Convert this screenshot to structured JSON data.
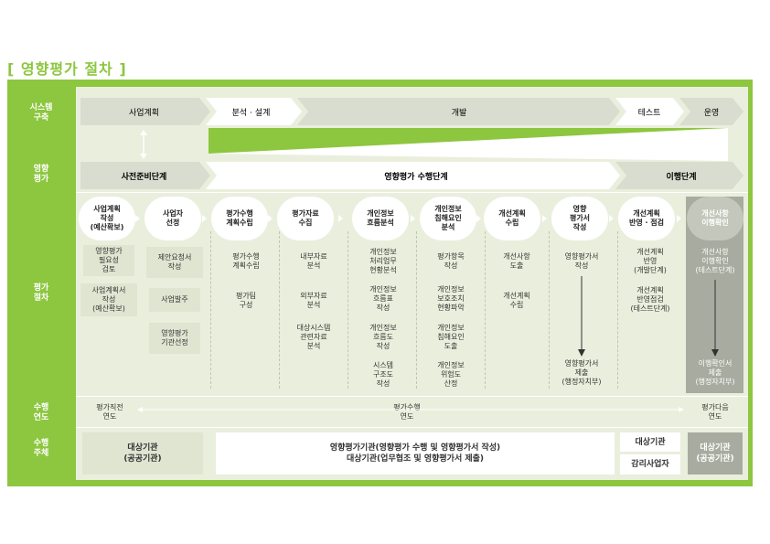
{
  "title": "[ 영향평가 절차 ]",
  "row_labels": {
    "system": "시스템\n구축",
    "assessment": "영향\n평가",
    "procedure": "평가\n절차",
    "period": "수행\n연도",
    "actor": "수행\n주체"
  },
  "system_row": [
    "사업계획",
    "분석 · 설계",
    "개발",
    "테스트",
    "운영"
  ],
  "assessment_row": [
    "사전준비단계",
    "영향평가 수행단계",
    "이행단계"
  ],
  "steps": [
    "사업계획\n작성\n(예산확보)",
    "사업자\n선정",
    "평가수행\n계획수립",
    "평가자료\n수집",
    "개인정보\n흐름분석",
    "개인정보\n침해요인\n분석",
    "개선계획\n수립",
    "영향\n평가서\n작성",
    "개선계획\n반영 · 점검",
    "개선사항\n이행확인"
  ],
  "tasks": {
    "c1": [
      "영향평가\n필요성\n검토",
      "사업계획서\n작성\n(예산확보)"
    ],
    "c2": [
      "제안요청서\n작성",
      "사업발주",
      "영향평가\n기관선정"
    ],
    "c3": [
      "평가수행\n계획수립",
      "평가팀\n구성"
    ],
    "c4": [
      "내부자료\n분석",
      "외부자료\n분석",
      "대상시스템\n관련자료\n분석"
    ],
    "c5": [
      "개인정보\n처리업무\n현황분석",
      "개인정보\n흐름표\n작성",
      "개인정보\n흐름도\n작성",
      "시스템\n구조도\n작성"
    ],
    "c6": [
      "평가항목\n작성",
      "개인정보\n보호조치\n현황파악",
      "개인정보\n침해요인\n도출",
      "개인정보\n위험도\n산정"
    ],
    "c7": [
      "개선사항\n도출",
      "개선계획\n수립"
    ],
    "c8": [
      "영향평가서\n작성",
      "영향평가서\n제출\n(행정자치부)"
    ],
    "c9": [
      "개선계획\n반영\n(개발단계)",
      "개선계획\n반영점검\n(테스트단계)"
    ],
    "c10": [
      "개선사항\n이행확인\n(테스트단계)",
      "이행확인서\n제출\n(행정자치부)"
    ]
  },
  "period_row": [
    "평가직전\n연도",
    "평가수행\n연도",
    "평가다음\n연도"
  ],
  "actor_row": [
    "대상기관\n(공공기관)",
    "영향평가기관(영향평가 수행 및 영향평가서 작성)\n대상기관(업무협조 및 영향평가서 제출)",
    "대상기관",
    "감리사업자",
    "대상기관\n(공공기관)"
  ],
  "colors": {
    "frame": "#8dc63f",
    "panel": "#e9efdc",
    "dark_grey": "#a8ab9f",
    "chevron_grey": "#d9ddd0",
    "title": "#8cc63f"
  }
}
